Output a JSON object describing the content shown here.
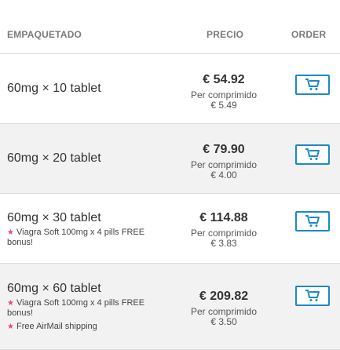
{
  "table": {
    "headers": {
      "package": "EMPAQUETADO",
      "price": "PRECIO",
      "order": "ORDER"
    },
    "rows": [
      {
        "package": "60mg × 10 tablet",
        "bonus": [],
        "total": "€ 54.92",
        "per_label": "Per comprimido",
        "per_value": "€ 5.49",
        "order_icon": "cart-icon"
      },
      {
        "package": "60mg × 20 tablet",
        "bonus": [],
        "total": "€ 79.90",
        "per_label": "Per comprimido",
        "per_value": "€ 4.00",
        "order_icon": "cart-icon"
      },
      {
        "package": "60mg × 30 tablet",
        "bonus": [
          "Viagra Soft 100mg x 4 pills FREE bonus!"
        ],
        "total": "€ 114.88",
        "per_label": "Per comprimido",
        "per_value": "€ 3.83",
        "order_icon": "cart-icon"
      },
      {
        "package": "60mg × 60 tablet",
        "bonus": [
          "Viagra Soft 100mg x 4 pills FREE bonus!",
          "Free AirMail shipping"
        ],
        "total": "€ 209.82",
        "per_label": "Per comprimido",
        "per_value": "€ 3.50",
        "order_icon": "cart-icon"
      }
    ]
  },
  "colors": {
    "accent": "#1e88c8",
    "star": "#e34a6f",
    "row_alt": "#f2f2f2"
  }
}
